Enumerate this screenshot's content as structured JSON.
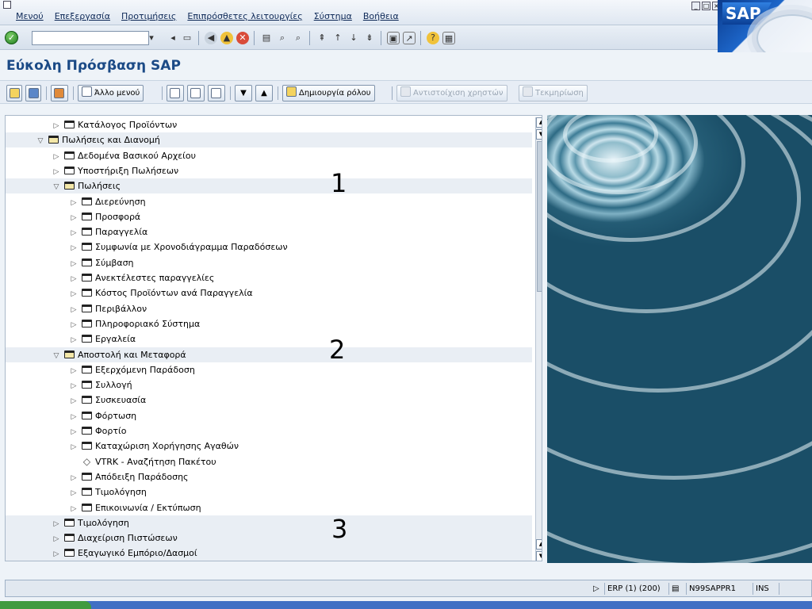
{
  "menubar": {
    "items": [
      "Μενού",
      "Επεξεργασία",
      "Προτιμήσεις",
      "Επιπρόσθετες λειτουργίες",
      "Σύστημα",
      "Βοήθεια"
    ]
  },
  "brand": {
    "logo_text": "SAP"
  },
  "toolbar": {
    "command_field": {
      "value": ""
    }
  },
  "page": {
    "title": "Εύκολη Πρόσβαση SAP"
  },
  "app_toolbar": {
    "other_menu": "Άλλο μενού",
    "create_role": "Δημιουργία ρόλου",
    "assign_users": "Αντιστοίχιση χρηστών",
    "documentation": "Τεκμηρίωση"
  },
  "tree": {
    "rows": [
      {
        "label": "Κατάλογος Προϊόντων",
        "level": 2,
        "kind": "folder",
        "expanded": false
      },
      {
        "label": "Πωλήσεις και Διανομή",
        "level": 1,
        "kind": "folder",
        "expanded": true
      },
      {
        "label": "Δεδομένα Βασικού Αρχείου",
        "level": 2,
        "kind": "folder",
        "expanded": false
      },
      {
        "label": "Υποστήριξη Πωλήσεων",
        "level": 2,
        "kind": "folder",
        "expanded": false
      },
      {
        "label": "Πωλήσεις",
        "level": 2,
        "kind": "folder",
        "expanded": true
      },
      {
        "label": "Διερεύνηση",
        "level": 3,
        "kind": "folder",
        "expanded": false
      },
      {
        "label": "Προσφορά",
        "level": 3,
        "kind": "folder",
        "expanded": false
      },
      {
        "label": "Παραγγελία",
        "level": 3,
        "kind": "folder",
        "expanded": false
      },
      {
        "label": "Συμφωνία με Χρονοδιάγραμμα Παραδόσεων",
        "level": 3,
        "kind": "folder",
        "expanded": false
      },
      {
        "label": "Σύμβαση",
        "level": 3,
        "kind": "folder",
        "expanded": false
      },
      {
        "label": "Ανεκτέλεστες παραγγελίες",
        "level": 3,
        "kind": "folder",
        "expanded": false
      },
      {
        "label": "Κόστος Προϊόντων ανά Παραγγελία",
        "level": 3,
        "kind": "folder",
        "expanded": false
      },
      {
        "label": "Περιβάλλον",
        "level": 3,
        "kind": "folder",
        "expanded": false
      },
      {
        "label": "Πληροφοριακό Σύστημα",
        "level": 3,
        "kind": "folder",
        "expanded": false
      },
      {
        "label": "Εργαλεία",
        "level": 3,
        "kind": "folder",
        "expanded": false
      },
      {
        "label": "Αποστολή και Μεταφορά",
        "level": 2,
        "kind": "folder",
        "expanded": true
      },
      {
        "label": "Εξερχόμενη Παράδοση",
        "level": 3,
        "kind": "folder",
        "expanded": false
      },
      {
        "label": "Συλλογή",
        "level": 3,
        "kind": "folder",
        "expanded": false
      },
      {
        "label": "Συσκευασία",
        "level": 3,
        "kind": "folder",
        "expanded": false
      },
      {
        "label": "Φόρτωση",
        "level": 3,
        "kind": "folder",
        "expanded": false
      },
      {
        "label": "Φορτίο",
        "level": 3,
        "kind": "folder",
        "expanded": false
      },
      {
        "label": "Καταχώριση Χορήγησης Αγαθών",
        "level": 3,
        "kind": "folder",
        "expanded": false
      },
      {
        "label": "VTRK - Αναζήτηση Πακέτου",
        "level": 3,
        "kind": "transaction",
        "expanded": false
      },
      {
        "label": "Απόδειξη Παράδοσης",
        "level": 3,
        "kind": "folder",
        "expanded": false
      },
      {
        "label": "Τιμολόγηση",
        "level": 3,
        "kind": "folder",
        "expanded": false
      },
      {
        "label": "Επικοινωνία / Εκτύπωση",
        "level": 3,
        "kind": "folder",
        "expanded": false
      },
      {
        "label": "Τιμολόγηση",
        "level": 2,
        "kind": "folder",
        "expanded": false
      },
      {
        "label": "Διαχείριση Πιστώσεων",
        "level": 2,
        "kind": "folder",
        "expanded": false
      },
      {
        "label": "Εξαγωγικό Εμπόριο/Δασμοί",
        "level": 2,
        "kind": "folder",
        "expanded": false
      }
    ]
  },
  "annotations": [
    "1",
    "2",
    "3"
  ],
  "statusbar": {
    "system": "ERP (1) (200)",
    "server": "N99SAPPR1",
    "mode": "INS"
  },
  "colors": {
    "title": "#1b4a86",
    "accent": "#0b3f95",
    "tree_shade": "#e9eef4"
  }
}
